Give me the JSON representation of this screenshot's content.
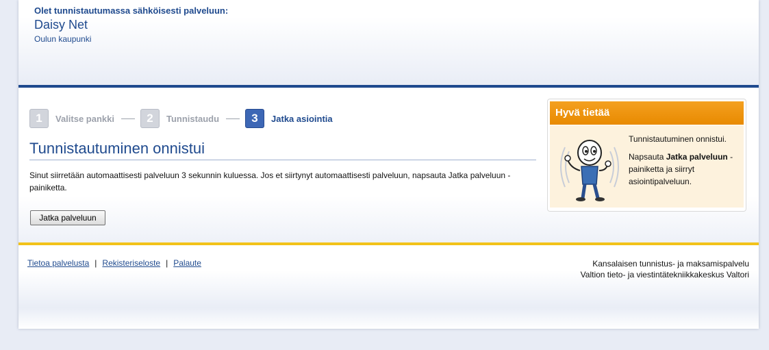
{
  "header": {
    "intro": "Olet tunnistautumassa sähköisesti palveluun:",
    "service_name": "Daisy Net",
    "organization": "Oulun kaupunki"
  },
  "steps": [
    {
      "number": "1",
      "label": "Valitse pankki",
      "state": "inactive"
    },
    {
      "number": "2",
      "label": "Tunnistaudu",
      "state": "inactive"
    },
    {
      "number": "3",
      "label": "Jatka asiointia",
      "state": "active"
    }
  ],
  "main": {
    "title": "Tunnistautuminen onnistui",
    "description": "Sinut siirretään automaattisesti palveluun 3 sekunnin kuluessa. Jos et siirtynyt automaattisesti palveluun, napsauta Jatka palveluun -painiketta.",
    "continue_button": "Jatka palveluun"
  },
  "info_box": {
    "title": "Hyvä tietää",
    "line1": "Tunnistautuminen onnistui.",
    "line2_prefix": "Napsauta ",
    "line2_bold": "Jatka palveluun",
    "line2_suffix": " -painiketta ja siirryt asiointipalveluun.",
    "mascot_icon": "mascot-waving-icon"
  },
  "footer": {
    "links": [
      "Tietoa palvelusta",
      "Rekisteriseloste",
      "Palaute"
    ],
    "separator": "|",
    "right_line1": "Kansalaisen tunnistus- ja maksamispalvelu",
    "right_line2": "Valtion tieto- ja viestintätekniikkakeskus Valtori"
  },
  "colors": {
    "primary_blue": "#1f4a8e",
    "active_step": "#3d67b5",
    "accent_orange": "#e88a00",
    "gold_bar": "#f2c21a"
  }
}
